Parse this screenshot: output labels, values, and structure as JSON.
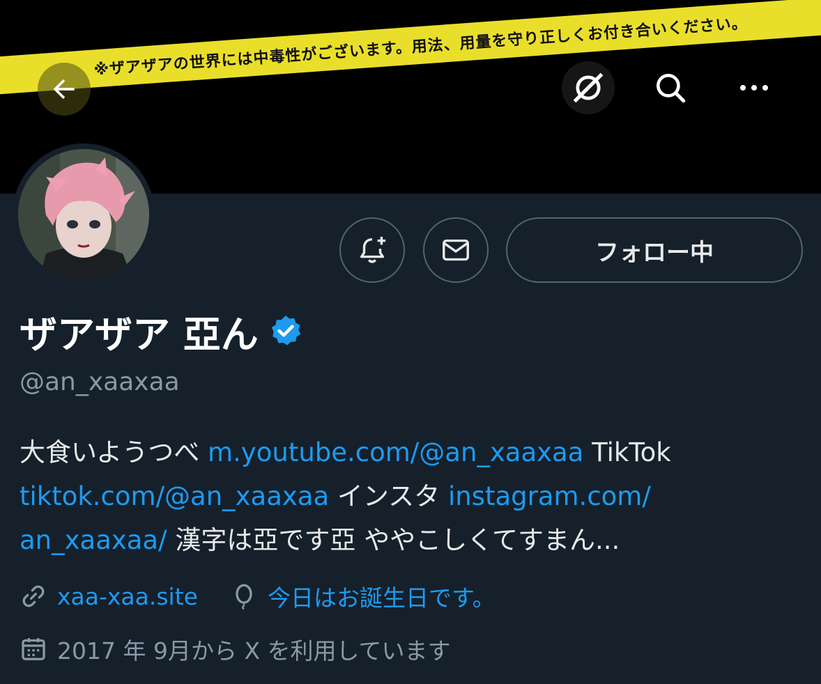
{
  "banner": {
    "tape_text": "※ザアザアの世界には中毒性がございます。用法、用量を守り正しくお付き合いください。"
  },
  "nav": {
    "back_icon": "arrow-left-icon",
    "grok_icon": "grok-icon",
    "search_icon": "search-icon",
    "more_icon": "more-dots-icon"
  },
  "actions": {
    "follow_label": "フォロー中"
  },
  "profile": {
    "display_name": "ザアザア 亞ん",
    "handle": "@an_xaaxaa"
  },
  "bio": {
    "t1": "大食いようつべ ",
    "l1": "m.youtube.com/@an_xaaxaa",
    "t2": " TikTok ",
    "l2": "tiktok.com/@an_xaaxaa",
    "t3": " インスタ ",
    "l3": "instagram.com/",
    "l3b": "an_xaaxaa/",
    "t4": " 漢字は亞です亞 ややこしくてすまん..."
  },
  "meta": {
    "website": "xaa-xaa.site",
    "birthday": "今日はお誕生日です。",
    "joined": "2017 年 9月から X を利用しています"
  },
  "colors": {
    "background": "#15202b",
    "link": "#1d9bf0",
    "muted": "#8b98a5",
    "tape": "#e9df2a"
  }
}
